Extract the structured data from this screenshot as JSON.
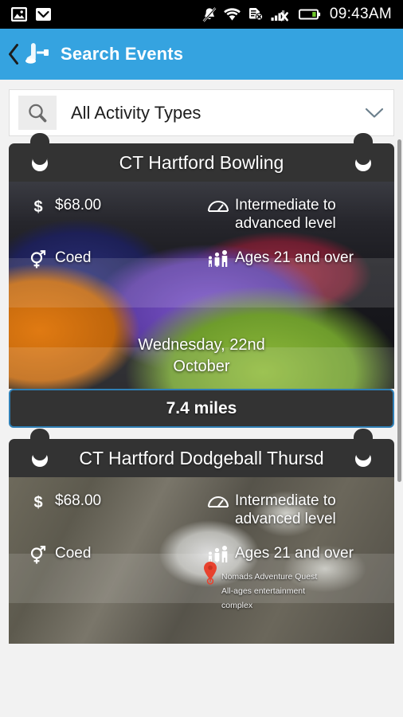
{
  "status_bar": {
    "left_icons": [
      "image-icon",
      "mail-icon"
    ],
    "right_icons": [
      "mute-bell-icon",
      "wifi-icon",
      "sim-card-x-icon",
      "signal-bars-x-icon",
      "battery-icon"
    ],
    "time": "09:43AM"
  },
  "action_bar": {
    "back_icon": "back-chevron-icon",
    "logo_icon": "app-logo-icon",
    "title": "Search Events"
  },
  "search": {
    "icon": "search-icon",
    "value": "All Activity Types",
    "placeholder": "All Activity Types",
    "dropdown_icon": "chevron-down-icon"
  },
  "colors": {
    "accent_blue": "#35a3e0",
    "card_dark": "#333333",
    "footer_border": "#2f7fb5",
    "page_bg": "#f2f2f2",
    "status_bg": "#000000"
  },
  "cards": [
    {
      "title": "CT Hartford Bowling",
      "image": "bowling-balls-photo",
      "details": [
        {
          "icon": "dollar-icon",
          "text": "$68.00"
        },
        {
          "icon": "gauge-icon",
          "text": "Intermediate to advanced level"
        },
        {
          "icon": "gender-coed-icon",
          "text": "Coed"
        },
        {
          "icon": "people-ages-icon",
          "text": "Ages 21 and over"
        }
      ],
      "date_line1": "Wednesday, 22nd",
      "date_line2": "October",
      "distance": "7.4 miles"
    },
    {
      "title": "CT Hartford Dodgeball Thursd",
      "image": "satellite-map",
      "details": [
        {
          "icon": "dollar-icon",
          "text": "$68.00"
        },
        {
          "icon": "gauge-icon",
          "text": "Intermediate to advanced level"
        },
        {
          "icon": "gender-coed-icon",
          "text": "Coed"
        },
        {
          "icon": "people-ages-icon",
          "text": "Ages 21 and over"
        }
      ],
      "map_pin": {
        "icon": "map-pin-icon",
        "name": "Nomads Adventure Quest",
        "description_line1": "All-ages entertainment",
        "description_line2": "complex"
      }
    }
  ]
}
